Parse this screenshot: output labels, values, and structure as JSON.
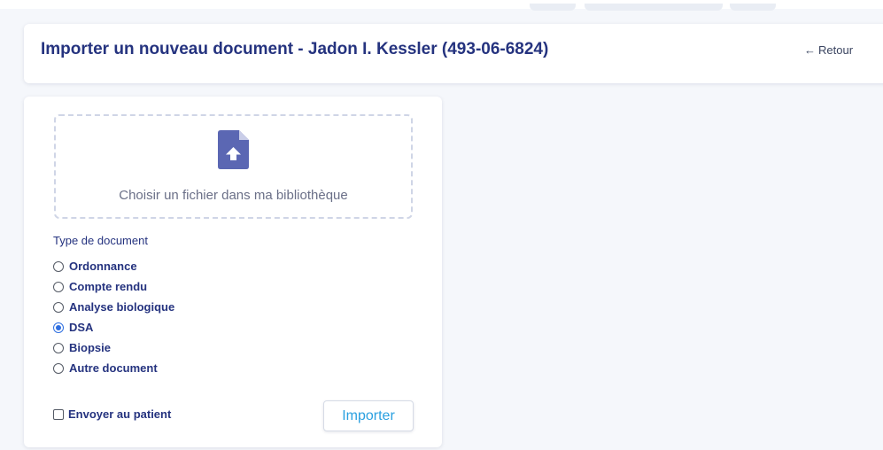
{
  "header": {
    "title": "Importer un nouveau document - Jadon I. Kessler (493-06-6824)",
    "back_arrow": "←",
    "back_label": "Retour"
  },
  "upload": {
    "icon": "file-upload-icon",
    "label": "Choisir un fichier dans ma bibliothèque"
  },
  "document_type": {
    "heading": "Type de document",
    "options": [
      {
        "label": "Ordonnance",
        "checked": false
      },
      {
        "label": "Compte rendu",
        "checked": false
      },
      {
        "label": "Analyse biologique",
        "checked": false
      },
      {
        "label": "DSA",
        "checked": true
      },
      {
        "label": "Biopsie",
        "checked": false
      },
      {
        "label": "Autre document",
        "checked": false
      }
    ]
  },
  "send_to_patient": {
    "label": "Envoyer au patient",
    "checked": false
  },
  "import_button": {
    "label": "Importer"
  },
  "colors": {
    "title": "#25337f",
    "icon": "#5b67b3",
    "button_text": "#2aa0e0",
    "radio_checked": "#2f6fe0"
  }
}
